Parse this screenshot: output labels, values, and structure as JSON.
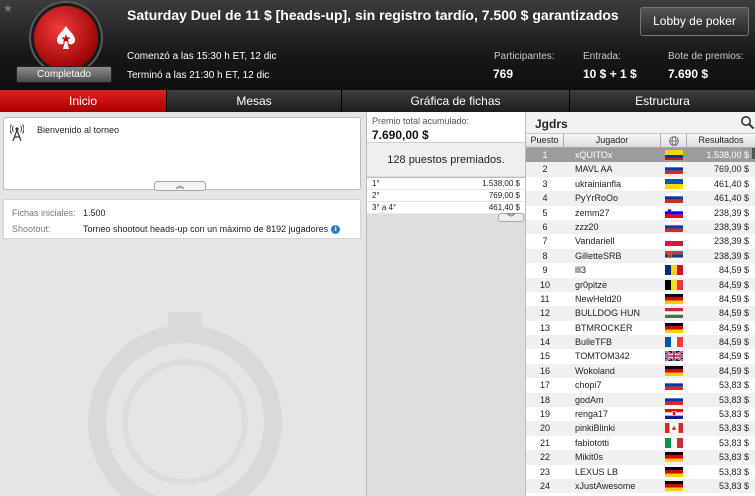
{
  "header": {
    "title": "Saturday Duel de 11 $ [heads-up], sin registro tardío, 7.500 $ garantizados",
    "status": "Completado",
    "lobby_button": "Lobby de poker",
    "started": "Comenzó a las 15:30 h ET, 12 dic",
    "ended": "Terminó a las 21:30 h ET, 12 dic",
    "stats": {
      "participants_label": "Participantes:",
      "participants_value": "769",
      "entry_label": "Entrada:",
      "entry_value": "10 $ + 1 $",
      "prize_label": "Bote de premios:",
      "prize_value": "7.690 $"
    },
    "colors": {
      "brand_red": "#d10f0f",
      "tab_active": "#c80a0a"
    }
  },
  "tabs": [
    "Inicio",
    "Mesas",
    "Gráfica de fichas",
    "Estructura"
  ],
  "welcome": {
    "text": "Bienvenido al torneo",
    "icon": "broadcast-icon"
  },
  "info": {
    "chips_label": "Fichas iniciales:",
    "chips_value": "1.500",
    "shootout_label": "Shootout:",
    "shootout_value": "Torneo shootout heads-up con un máximo de 8192 jugadores"
  },
  "prize_panel": {
    "total_label": "Premio total acumulado:",
    "total_value": "7.690,00 $",
    "paid_places": "128 puestos premiados.",
    "payouts": [
      {
        "pos": "1°",
        "amount": "1.538,00 $"
      },
      {
        "pos": "2°",
        "amount": "769,00 $"
      },
      {
        "pos": "3° a 4°",
        "amount": "461,40 $"
      }
    ]
  },
  "players": {
    "title": "Jgdrs",
    "columns": {
      "pos": "Puesto",
      "player": "Jugador",
      "results": "Resultados"
    },
    "rows": [
      {
        "pos": "1",
        "name": "xQUITOx",
        "flag": "colombia",
        "result": "1.538,00 $"
      },
      {
        "pos": "2",
        "name": "MAVL AA",
        "flag": "russia",
        "result": "769,00 $"
      },
      {
        "pos": "3",
        "name": "ukrainianfla",
        "flag": "ukraine",
        "result": "461,40 $"
      },
      {
        "pos": "4",
        "name": "PyYrRoOo",
        "flag": "russia",
        "result": "461,40 $"
      },
      {
        "pos": "5",
        "name": "zemm27",
        "flag": "slovenia",
        "result": "238,39 $"
      },
      {
        "pos": "6",
        "name": "zzz20",
        "flag": "russia",
        "result": "238,39 $"
      },
      {
        "pos": "7",
        "name": "Vandariell",
        "flag": "poland",
        "result": "238,39 $"
      },
      {
        "pos": "8",
        "name": "GilletteSRB",
        "flag": "serbia",
        "result": "238,39 $"
      },
      {
        "pos": "9",
        "name": "lll3",
        "flag": "romania",
        "result": "84,59 $"
      },
      {
        "pos": "10",
        "name": "gr0pitze",
        "flag": "belgium",
        "result": "84,59 $"
      },
      {
        "pos": "11",
        "name": "NewHeld20",
        "flag": "germany",
        "result": "84,59 $"
      },
      {
        "pos": "12",
        "name": "BULLDOG HUN",
        "flag": "hungary",
        "result": "84,59 $"
      },
      {
        "pos": "13",
        "name": "BTMROCKER",
        "flag": "germany",
        "result": "84,59 $"
      },
      {
        "pos": "14",
        "name": "BulleTFB",
        "flag": "france",
        "result": "84,59 $"
      },
      {
        "pos": "15",
        "name": "TOMTOM342",
        "flag": "uk",
        "result": "84,59 $"
      },
      {
        "pos": "16",
        "name": "Wokoland",
        "flag": "germany",
        "result": "84,59 $"
      },
      {
        "pos": "17",
        "name": "chopi7",
        "flag": "russia",
        "result": "53,83 $"
      },
      {
        "pos": "18",
        "name": "godAm",
        "flag": "russia",
        "result": "53,83 $"
      },
      {
        "pos": "19",
        "name": "renga17",
        "flag": "croatia",
        "result": "53,83 $"
      },
      {
        "pos": "20",
        "name": "pinkiBlinki",
        "flag": "canada",
        "result": "53,83 $"
      },
      {
        "pos": "21",
        "name": "fabiototti",
        "flag": "italy",
        "result": "53,83 $"
      },
      {
        "pos": "22",
        "name": "Mikit0s",
        "flag": "germany",
        "result": "53,83 $"
      },
      {
        "pos": "23",
        "name": "LEXUS LB",
        "flag": "germany",
        "result": "53,83 $"
      },
      {
        "pos": "24",
        "name": "xJustAwesome",
        "flag": "germany",
        "result": "53,83 $"
      }
    ]
  }
}
